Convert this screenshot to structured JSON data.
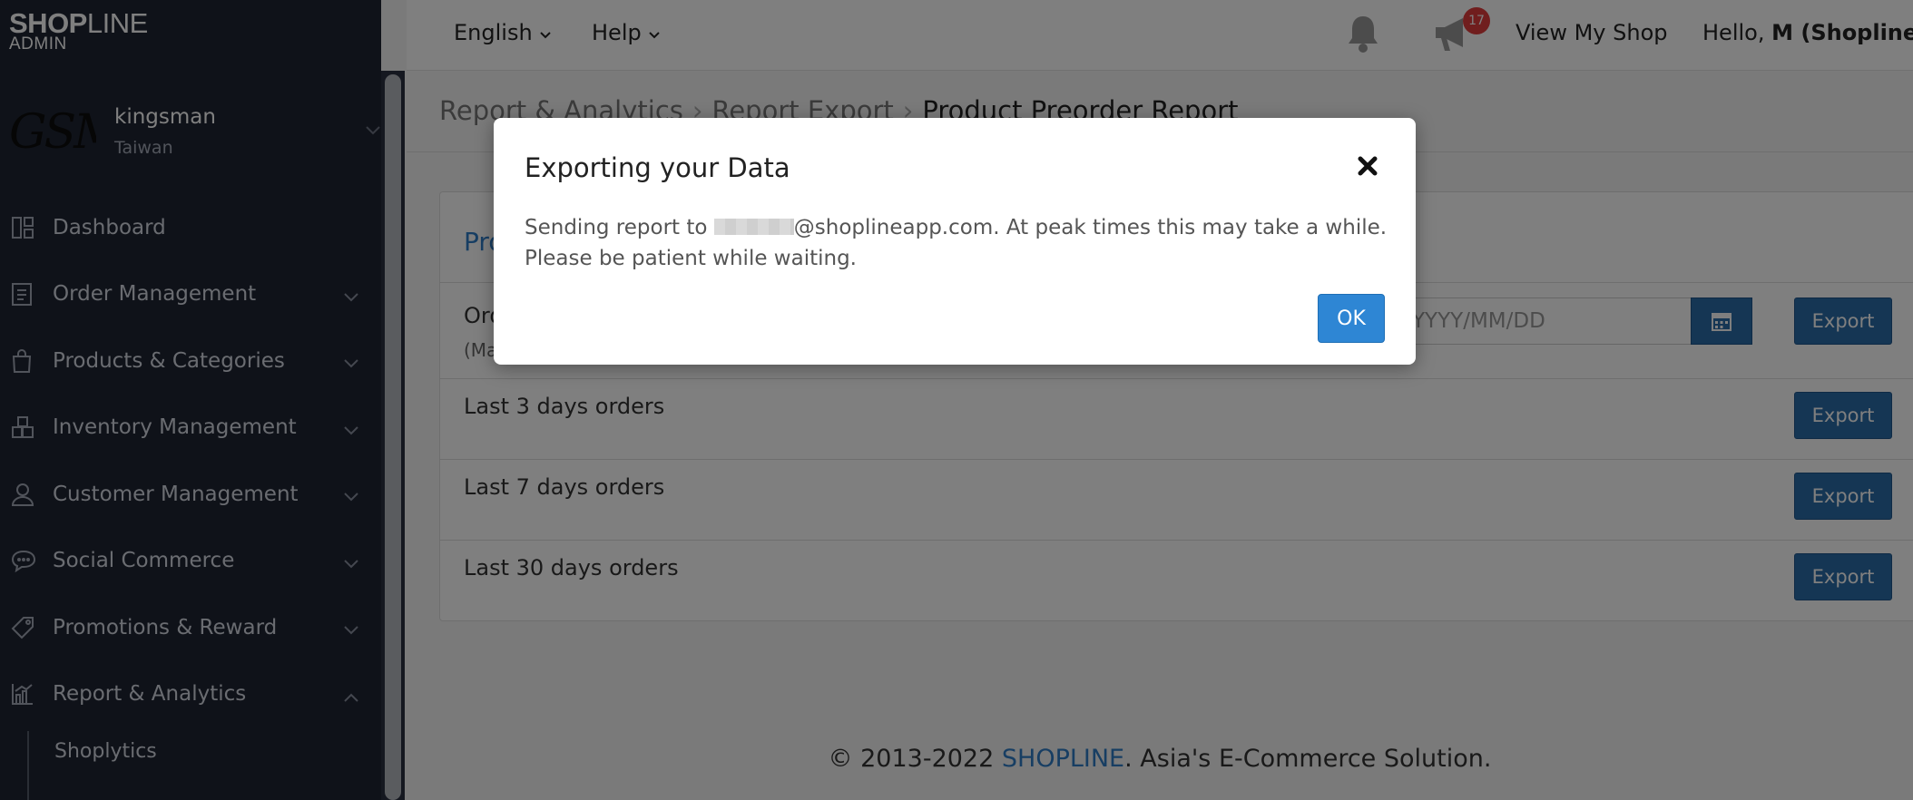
{
  "logo": {
    "brand_bold": "SHOP",
    "brand_light": "LINE",
    "sub": "ADMIN"
  },
  "shop": {
    "logo_text": "GSM",
    "name": "kingsman",
    "region": "Taiwan"
  },
  "nav": {
    "items": [
      {
        "label": "Dashboard",
        "icon": "dashboard-icon"
      },
      {
        "label": "Order Management",
        "icon": "clipboard-icon"
      },
      {
        "label": "Products & Categories",
        "icon": "bag-icon"
      },
      {
        "label": "Inventory Management",
        "icon": "boxes-icon"
      },
      {
        "label": "Customer Management",
        "icon": "user-icon"
      },
      {
        "label": "Social Commerce",
        "icon": "chat-icon"
      },
      {
        "label": "Promotions & Reward",
        "icon": "tag-icon"
      },
      {
        "label": "Report & Analytics",
        "icon": "chart-icon"
      }
    ],
    "sub_items": [
      "Shoplytics"
    ]
  },
  "topbar": {
    "language": "English",
    "help": "Help",
    "notification_count": "17",
    "view_shop": "View My Shop",
    "greeting": "Hello,",
    "user": "M (Shopline)"
  },
  "breadcrumb": {
    "level1": "Report & Analytics",
    "level2": "Report Export",
    "current": "Product Preorder Report"
  },
  "card": {
    "title": "Pro",
    "rows": [
      {
        "label": "Ord",
        "sub": "(Ma",
        "date_placeholder": "YYYY/MM/DD",
        "button": "Export"
      },
      {
        "label": "Last 3 days orders",
        "button": "Export"
      },
      {
        "label": "Last 7 days orders",
        "button": "Export"
      },
      {
        "label": "Last 30 days orders",
        "button": "Export"
      }
    ]
  },
  "footer": {
    "copyright": "© 2013-2022 ",
    "brand": "SHOPLINE",
    "tagline": ". Asia's E-Commerce Solution."
  },
  "modal": {
    "title": "Exporting your Data",
    "body_prefix": "Sending report to ",
    "email_domain": "@shoplineapp.com",
    "body_suffix": ". At peak times this may take a while. Please be patient while waiting.",
    "ok_label": "OK"
  },
  "colors": {
    "sidebar_bg": "#1f2533",
    "accent": "#2f7cc6",
    "button": "#2b6ca8",
    "badge": "#e03c3c"
  }
}
